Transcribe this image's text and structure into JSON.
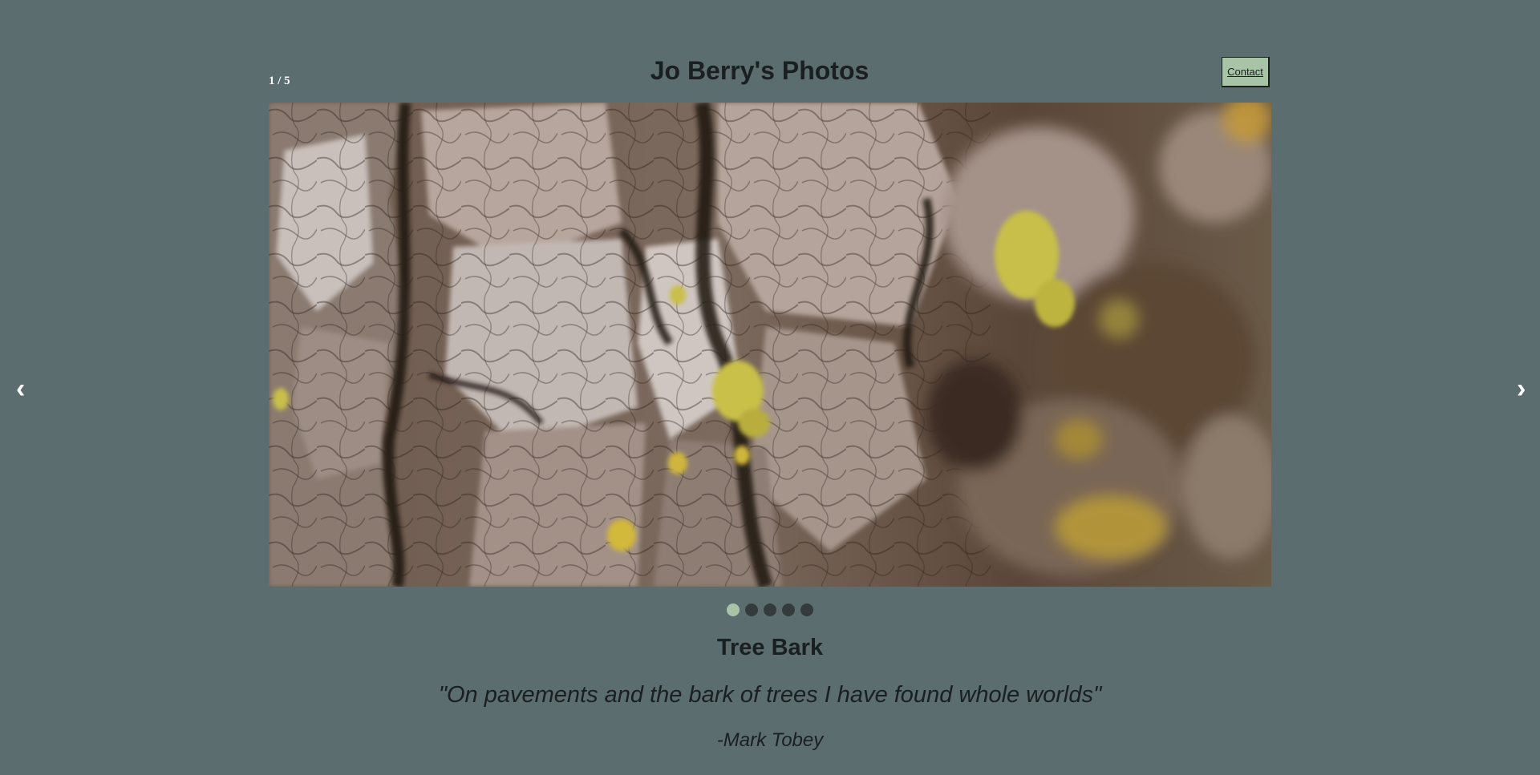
{
  "header": {
    "title": "Jo Berry's Photos",
    "contact_label": "Contact"
  },
  "slideshow": {
    "counter": "1 / 5",
    "prev_icon": "chevron-left-icon",
    "prev_glyph": "‹",
    "next_icon": "chevron-right-icon",
    "next_glyph": "›",
    "total_slides": 5,
    "active_index": 0,
    "current_photo_subject": "Tree bark with yellow lichen"
  },
  "caption": {
    "title": "Tree Bark",
    "quote": "\"On pavements and the bark of trees I have found whole worlds\"",
    "author": "-Mark Tobey"
  },
  "colors": {
    "background": "#5b6d6f",
    "accent": "#a9c3a6",
    "text": "#1a1f21",
    "dot_inactive": "#333b3c"
  }
}
